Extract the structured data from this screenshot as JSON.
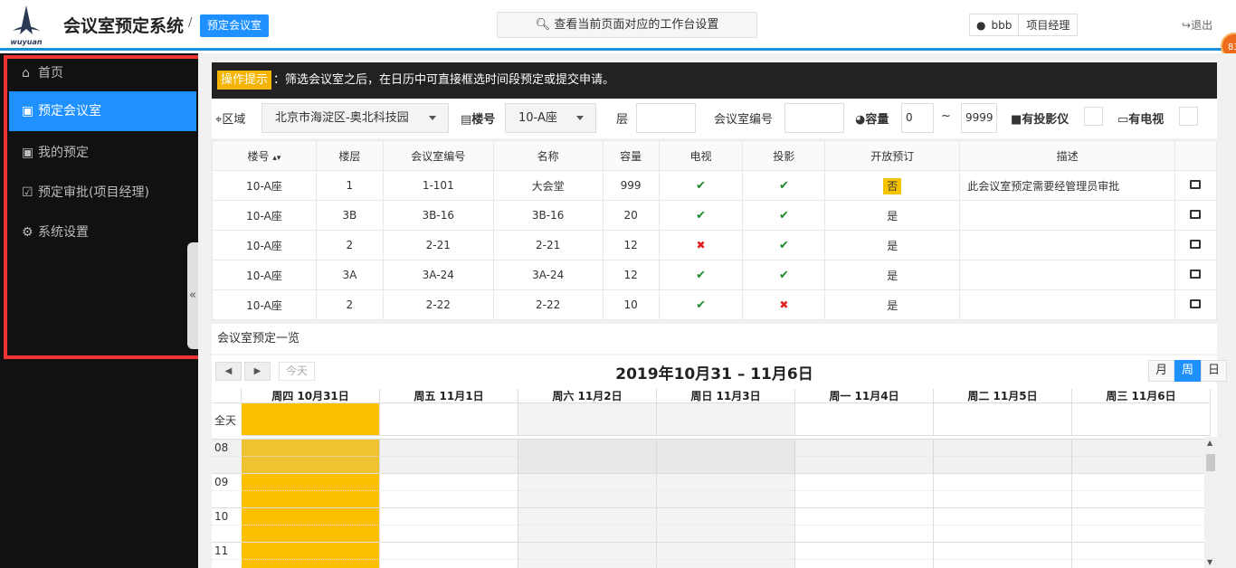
{
  "header": {
    "logo_text": "wuyuan",
    "app_title": "会议室预定系统",
    "crumb_sep": "/",
    "crumb_label": "预定会议室",
    "settings_label": "查看当前页面对应的工作台设置",
    "user_name": "bbb",
    "user_role": "项目经理",
    "logout_label": "退出",
    "badge_text": "83"
  },
  "sidebar": {
    "items": [
      {
        "label": "首页",
        "icon": "home-icon"
      },
      {
        "label": "预定会议室",
        "icon": "calendar-plus-icon"
      },
      {
        "label": "我的预定",
        "icon": "calendar-check-icon"
      },
      {
        "label": "预定审批(项目经理)",
        "icon": "check-square-icon"
      },
      {
        "label": "系统设置",
        "icon": "gears-icon"
      }
    ],
    "active_index": 1,
    "collapse_icon": "«"
  },
  "tip": {
    "tag": "操作提示",
    "text": "：筛选会议室之后，在日历中可直接框选时间段预定或提交申请。"
  },
  "filter": {
    "area_label": "区域",
    "area_value": "北京市海淀区-奥北科技园",
    "building_label": "楼号",
    "building_value": "10-A座",
    "floor_label": "层",
    "floor_value": "",
    "room_no_label": "会议室编号",
    "room_no_value": "",
    "capacity_label": "容量",
    "cap_min": "0",
    "cap_sep": "~",
    "cap_max": "9999",
    "projector_label": "有投影仪",
    "tv_label": "有电视"
  },
  "table": {
    "headers": [
      "楼号",
      "楼层",
      "会议室编号",
      "名称",
      "容量",
      "电视",
      "投影",
      "开放预订",
      "描述",
      ""
    ],
    "rows": [
      {
        "building": "10-A座",
        "floor": "1",
        "room_no": "1-101",
        "name": "大会堂",
        "capacity": "999",
        "tv": true,
        "projector": true,
        "open": "否",
        "desc": "此会议室预定需要经管理员审批"
      },
      {
        "building": "10-A座",
        "floor": "3B",
        "room_no": "3B-16",
        "name": "3B-16",
        "capacity": "20",
        "tv": true,
        "projector": true,
        "open": "是",
        "desc": ""
      },
      {
        "building": "10-A座",
        "floor": "2",
        "room_no": "2-21",
        "name": "2-21",
        "capacity": "12",
        "tv": false,
        "projector": true,
        "open": "是",
        "desc": ""
      },
      {
        "building": "10-A座",
        "floor": "3A",
        "room_no": "3A-24",
        "name": "3A-24",
        "capacity": "12",
        "tv": true,
        "projector": true,
        "open": "是",
        "desc": ""
      },
      {
        "building": "10-A座",
        "floor": "2",
        "room_no": "2-22",
        "name": "2-22",
        "capacity": "10",
        "tv": true,
        "projector": false,
        "open": "是",
        "desc": ""
      }
    ]
  },
  "list_title": "会议室预定一览",
  "calendar": {
    "title": "2019年10月31 – 11月6日",
    "today_label": "今天",
    "views": [
      "月",
      "周",
      "日"
    ],
    "active_view": "周",
    "days": [
      "周四 10月31日",
      "周五 11月1日",
      "周六 11月2日",
      "周日 11月3日",
      "周一 11月4日",
      "周二 11月5日",
      "周三 11月6日"
    ],
    "allday_label": "全天",
    "hours": [
      "08",
      "09",
      "10",
      "11"
    ]
  },
  "colors": {
    "accent": "#1e90ff",
    "sidebar_bg": "#111111",
    "today_fill": "#fcc000",
    "highlight": "#ee3333"
  }
}
